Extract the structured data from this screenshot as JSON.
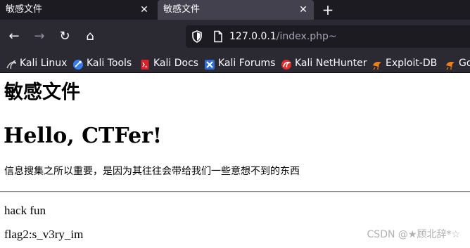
{
  "tabs": [
    {
      "title": "敏感文件",
      "active": false,
      "close_glyph": "✕"
    },
    {
      "title": "敏感文件",
      "active": true,
      "close_glyph": "✕"
    }
  ],
  "new_tab_glyph": "+",
  "nav": {
    "back_glyph": "←",
    "forward_glyph": "→",
    "reload_glyph": "↻",
    "home_glyph": "⌂"
  },
  "address_bar": {
    "host": "127.0.0.1",
    "path": "/index.php~"
  },
  "bookmarks": [
    {
      "label": "Kali Linux",
      "icon": "kali-dragon-icon"
    },
    {
      "label": "Kali Tools",
      "icon": "kali-tools-icon"
    },
    {
      "label": "Kali Docs",
      "icon": "kali-docs-icon"
    },
    {
      "label": "Kali Forums",
      "icon": "kali-forums-icon"
    },
    {
      "label": "Kali NetHunter",
      "icon": "nethunter-icon"
    },
    {
      "label": "Exploit-DB",
      "icon": "exploit-db-icon"
    },
    {
      "label": "Go",
      "icon": "ghdb-icon"
    }
  ],
  "page": {
    "heading": "敏感文件",
    "hello": "Hello, CTFer!",
    "description": "信息搜集之所以重要，是因为其往往会带给我们一些意想不到的东西",
    "hack_text": "hack fun",
    "flag_text": "flag2:s_v3ry_im"
  },
  "watermark": "CSDN @★顾北辞*☆",
  "colors": {
    "tab_strip": "#1c1b22",
    "toolbar": "#2b2a33",
    "active_tab": "#42414d",
    "url_field": "#1c1b22",
    "text_light": "#fbfbfe",
    "url_path": "#a3a3ab",
    "page_bg": "#ffffff"
  }
}
